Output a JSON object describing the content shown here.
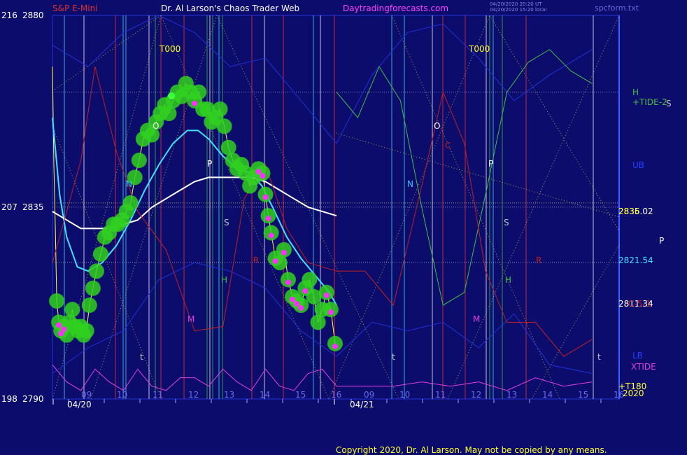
{
  "header": {
    "symbol": "S&P E-Mini",
    "site_title": "Dr. Al Larson's Chaos Trader Web",
    "site_url": "Daytradingforecasts.com",
    "ts_line1": "04/20/2020 20:20 UT",
    "ts_line2": "04/20/2020 15:20 local",
    "file": "spcform.txt"
  },
  "copyright": "Copyright 2020, Dr. Al Larson. May not be copied by any means.",
  "colors": {
    "background": "#0c0c6c",
    "price": "#ffff30",
    "average_fast": "#40e0ff",
    "average_slow": "#ffffff",
    "tide": "#40c040",
    "cycle_red": "#c02020",
    "xtide": "#e040e0",
    "band_blue": "#2030d8",
    "energy_glow": "#30d020",
    "magenta_dots": "#ff30ff"
  },
  "chart_data": {
    "type": "line",
    "title": "S&P E-Mini",
    "y_left_price_ticks": [
      {
        "left": "216",
        "price": "2880",
        "value": 2880
      },
      {
        "left": "207",
        "price": "2835",
        "value": 2835
      },
      {
        "left": "198",
        "price": "2790",
        "value": 2790
      }
    ],
    "ylim": [
      2790,
      2880
    ],
    "x_hour_ticks": [
      "09",
      "10",
      "11",
      "12",
      "13",
      "14",
      "15",
      "16",
      "09",
      "10",
      "11",
      "12",
      "13",
      "14",
      "15",
      "16"
    ],
    "x_dates": [
      "04/20",
      "04/21"
    ],
    "right_labels": [
      {
        "text": "H",
        "color": "#40c040"
      },
      {
        "text": "+TIDE-2",
        "color": "#40c040"
      },
      {
        "text": "S",
        "color": "#c0c0c0"
      },
      {
        "text": "UB",
        "color": "#2040ff"
      },
      {
        "text": "2835.02",
        "color": "#ffffff",
        "value": 2835.02
      },
      {
        "text": "2836",
        "color": "#ffff30",
        "value": 2836
      },
      {
        "text": "P",
        "color": "#ffffff"
      },
      {
        "text": "2821.54",
        "color": "#40e0ff",
        "value": 2821.54
      },
      {
        "text": "2811.34",
        "color": "#ffffff",
        "value": 2811.34
      },
      {
        "text": "C-5-1",
        "color": "#c02020"
      },
      {
        "text": "LB",
        "color": "#2040ff"
      },
      {
        "text": "XTIDE",
        "color": "#e040e0"
      },
      {
        "text": "+T180",
        "color": "#ffff30"
      },
      {
        "text": "2020",
        "color": "#ffff30"
      }
    ],
    "chart_labels": [
      {
        "text": "T000",
        "color": "#ffff30"
      },
      {
        "text": "T000",
        "color": "#ffff30"
      },
      {
        "text": "N",
        "color": "#40c0ff"
      },
      {
        "text": "N",
        "color": "#40c0ff"
      },
      {
        "text": "O",
        "color": "#ffffff"
      },
      {
        "text": "O",
        "color": "#ffffff"
      },
      {
        "text": "P",
        "color": "#ffffff"
      },
      {
        "text": "P",
        "color": "#ffffff"
      },
      {
        "text": "S",
        "color": "#c0c0c0"
      },
      {
        "text": "S",
        "color": "#c0c0c0"
      },
      {
        "text": "H",
        "color": "#40c040"
      },
      {
        "text": "H",
        "color": "#40c040"
      },
      {
        "text": "R",
        "color": "#c02020"
      },
      {
        "text": "R",
        "color": "#c02020"
      },
      {
        "text": "C",
        "color": "#c02020"
      },
      {
        "text": "M",
        "color": "#e040e0"
      },
      {
        "text": "M",
        "color": "#e040e0"
      },
      {
        "text": "t",
        "color": "#c0c0c0"
      },
      {
        "text": "t",
        "color": "#c0c0c0"
      },
      {
        "text": "t",
        "color": "#c0c0c0"
      }
    ],
    "series": [
      {
        "name": "price",
        "note_units": "price",
        "points": [
          [
            0.0,
            2868
          ],
          [
            0.02,
            2845
          ],
          [
            0.04,
            2830
          ],
          [
            0.06,
            2813
          ],
          [
            0.09,
            2808
          ],
          [
            0.12,
            2806
          ],
          [
            0.16,
            2807
          ],
          [
            0.2,
            2805
          ],
          [
            0.24,
            2808
          ],
          [
            0.28,
            2811
          ],
          [
            0.32,
            2807
          ],
          [
            0.36,
            2806
          ],
          [
            0.4,
            2807
          ],
          [
            0.44,
            2805
          ],
          [
            0.48,
            2806
          ],
          [
            0.52,
            2812
          ],
          [
            0.57,
            2816
          ],
          [
            0.62,
            2820
          ],
          [
            0.68,
            2824
          ],
          [
            0.74,
            2828
          ],
          [
            0.8,
            2829
          ],
          [
            0.86,
            2831
          ],
          [
            0.92,
            2831
          ],
          [
            0.98,
            2832
          ],
          [
            1.04,
            2834
          ],
          [
            1.1,
            2836
          ],
          [
            1.16,
            2842
          ],
          [
            1.22,
            2846
          ],
          [
            1.28,
            2851
          ],
          [
            1.34,
            2853
          ],
          [
            1.4,
            2852
          ],
          [
            1.46,
            2855
          ],
          [
            1.52,
            2857
          ],
          [
            1.58,
            2859
          ],
          [
            1.64,
            2857
          ],
          [
            1.7,
            2860
          ],
          [
            1.76,
            2862
          ],
          [
            1.82,
            2861
          ],
          [
            1.88,
            2864
          ],
          [
            1.94,
            2862
          ],
          [
            2.0,
            2860
          ],
          [
            2.06,
            2862
          ],
          [
            2.12,
            2858
          ],
          [
            2.18,
            2858
          ],
          [
            2.24,
            2855
          ],
          [
            2.3,
            2856
          ],
          [
            2.36,
            2858
          ],
          [
            2.42,
            2854
          ],
          [
            2.48,
            2849
          ],
          [
            2.54,
            2846
          ],
          [
            2.6,
            2844
          ],
          [
            2.66,
            2845
          ],
          [
            2.72,
            2843
          ],
          [
            2.78,
            2840
          ],
          [
            2.84,
            2842
          ],
          [
            2.9,
            2844
          ],
          [
            2.96,
            2843
          ],
          [
            3.0,
            2838
          ],
          [
            3.04,
            2833
          ],
          [
            3.08,
            2829
          ],
          [
            3.14,
            2823
          ],
          [
            3.2,
            2822
          ],
          [
            3.26,
            2825
          ],
          [
            3.32,
            2818
          ],
          [
            3.38,
            2814
          ],
          [
            3.44,
            2813
          ],
          [
            3.5,
            2812
          ],
          [
            3.56,
            2816
          ],
          [
            3.62,
            2818
          ],
          [
            3.68,
            2814
          ],
          [
            3.74,
            2808
          ],
          [
            3.8,
            2811
          ],
          [
            3.86,
            2815
          ],
          [
            3.92,
            2811
          ],
          [
            3.98,
            2803
          ]
        ]
      },
      {
        "name": "average_fast",
        "points": [
          [
            0,
            2856
          ],
          [
            0.1,
            2838
          ],
          [
            0.2,
            2828
          ],
          [
            0.35,
            2821
          ],
          [
            0.5,
            2820
          ],
          [
            0.7,
            2822
          ],
          [
            0.9,
            2826
          ],
          [
            1.1,
            2832
          ],
          [
            1.3,
            2839
          ],
          [
            1.5,
            2845
          ],
          [
            1.7,
            2850
          ],
          [
            1.9,
            2853
          ],
          [
            2.05,
            2853
          ],
          [
            2.2,
            2851
          ],
          [
            2.4,
            2847
          ],
          [
            2.6,
            2844
          ],
          [
            2.8,
            2843
          ],
          [
            2.95,
            2840
          ],
          [
            3.1,
            2835
          ],
          [
            3.3,
            2828
          ],
          [
            3.5,
            2823
          ],
          [
            3.7,
            2819
          ],
          [
            3.9,
            2815
          ],
          [
            4.0,
            2812
          ]
        ]
      },
      {
        "name": "average_slow",
        "points": [
          [
            0,
            2834
          ],
          [
            0.2,
            2832
          ],
          [
            0.4,
            2830
          ],
          [
            0.6,
            2830
          ],
          [
            0.8,
            2830
          ],
          [
            1.0,
            2831
          ],
          [
            1.2,
            2832
          ],
          [
            1.4,
            2835
          ],
          [
            1.6,
            2837
          ],
          [
            1.8,
            2839
          ],
          [
            2.0,
            2841
          ],
          [
            2.2,
            2842
          ],
          [
            2.4,
            2842
          ],
          [
            2.6,
            2842
          ],
          [
            2.8,
            2842
          ],
          [
            3.0,
            2841
          ],
          [
            3.2,
            2839
          ],
          [
            3.4,
            2837
          ],
          [
            3.6,
            2835
          ],
          [
            3.8,
            2834
          ],
          [
            4.0,
            2833
          ]
        ]
      },
      {
        "name": "+TIDE-2",
        "points": [
          [
            4.0,
            2862
          ],
          [
            4.3,
            2856
          ],
          [
            4.6,
            2868
          ],
          [
            4.9,
            2860
          ],
          [
            5.2,
            2835
          ],
          [
            5.5,
            2812
          ],
          [
            5.8,
            2815
          ],
          [
            6.1,
            2838
          ],
          [
            6.4,
            2862
          ],
          [
            6.7,
            2869
          ],
          [
            7.0,
            2872
          ],
          [
            7.3,
            2867
          ],
          [
            7.6,
            2864
          ]
        ]
      },
      {
        "name": "C-5-1",
        "points": [
          [
            0,
            2822
          ],
          [
            0.4,
            2846
          ],
          [
            0.6,
            2868
          ],
          [
            0.9,
            2848
          ],
          [
            1.2,
            2834
          ],
          [
            1.6,
            2825
          ],
          [
            2.0,
            2806
          ],
          [
            2.4,
            2807
          ],
          [
            2.7,
            2837
          ],
          [
            3.0,
            2845
          ],
          [
            3.3,
            2830
          ],
          [
            3.6,
            2822
          ],
          [
            4.0,
            2820
          ],
          [
            4.4,
            2820
          ],
          [
            4.8,
            2812
          ],
          [
            5.2,
            2840
          ],
          [
            5.5,
            2862
          ],
          [
            5.8,
            2850
          ],
          [
            6.1,
            2820
          ],
          [
            6.4,
            2808
          ],
          [
            6.8,
            2808
          ],
          [
            7.2,
            2800
          ],
          [
            7.6,
            2804
          ]
        ]
      },
      {
        "name": "XTIDE",
        "points": [
          [
            0,
            2798
          ],
          [
            0.2,
            2794
          ],
          [
            0.4,
            2792
          ],
          [
            0.6,
            2797
          ],
          [
            0.8,
            2794
          ],
          [
            1.0,
            2792
          ],
          [
            1.2,
            2797
          ],
          [
            1.4,
            2793
          ],
          [
            1.6,
            2792
          ],
          [
            1.8,
            2795
          ],
          [
            2.0,
            2795
          ],
          [
            2.2,
            2793
          ],
          [
            2.4,
            2797
          ],
          [
            2.6,
            2794
          ],
          [
            2.8,
            2792
          ],
          [
            3.0,
            2797
          ],
          [
            3.2,
            2793
          ],
          [
            3.4,
            2792
          ],
          [
            3.6,
            2796
          ],
          [
            3.8,
            2797
          ],
          [
            4.0,
            2793
          ],
          [
            4.4,
            2793
          ],
          [
            4.8,
            2793
          ],
          [
            5.2,
            2794
          ],
          [
            5.6,
            2793
          ],
          [
            6.0,
            2794
          ],
          [
            6.4,
            2792
          ],
          [
            6.8,
            2795
          ],
          [
            7.2,
            2793
          ],
          [
            7.6,
            2794
          ]
        ]
      }
    ],
    "grid": false
  }
}
